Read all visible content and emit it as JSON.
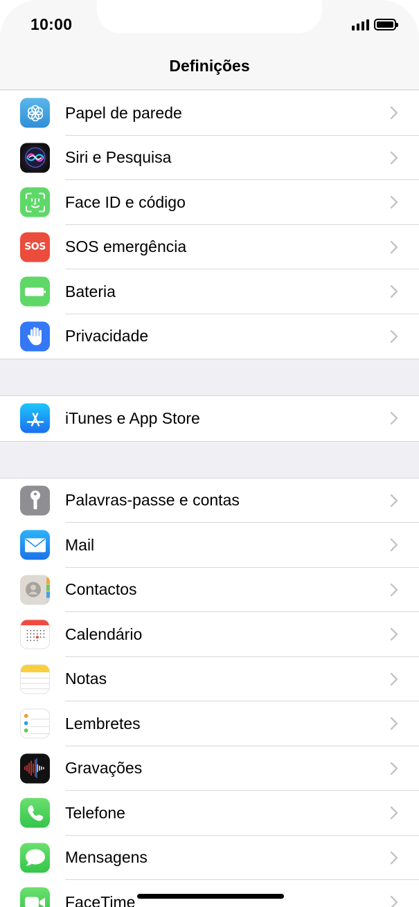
{
  "status_bar": {
    "time": "10:00"
  },
  "nav": {
    "title": "Definições"
  },
  "groups": [
    {
      "items": [
        {
          "label": "Papel de parede",
          "icon": "wallpaper-icon"
        },
        {
          "label": "Siri e Pesquisa",
          "icon": "siri-icon"
        },
        {
          "label": "Face ID e código",
          "icon": "face-id-icon"
        },
        {
          "label": "SOS emergência",
          "icon": "sos-icon",
          "icon_text": "SOS"
        },
        {
          "label": "Bateria",
          "icon": "battery-icon"
        },
        {
          "label": "Privacidade",
          "icon": "privacy-hand-icon"
        }
      ]
    },
    {
      "items": [
        {
          "label": "iTunes e App Store",
          "icon": "app-store-icon"
        }
      ]
    },
    {
      "items": [
        {
          "label": "Palavras-passe e contas",
          "icon": "key-icon"
        },
        {
          "label": "Mail",
          "icon": "mail-icon"
        },
        {
          "label": "Contactos",
          "icon": "contacts-icon"
        },
        {
          "label": "Calendário",
          "icon": "calendar-icon"
        },
        {
          "label": "Notas",
          "icon": "notes-icon"
        },
        {
          "label": "Lembretes",
          "icon": "reminders-icon"
        },
        {
          "label": "Gravações",
          "icon": "voice-memos-icon"
        },
        {
          "label": "Telefone",
          "icon": "phone-icon"
        },
        {
          "label": "Mensagens",
          "icon": "messages-icon"
        },
        {
          "label": "FaceTime",
          "icon": "facetime-icon"
        }
      ]
    }
  ],
  "colors": {
    "background": "#efeff4",
    "chevron": "#c4c4c7",
    "separator": "#d9d9dc"
  }
}
